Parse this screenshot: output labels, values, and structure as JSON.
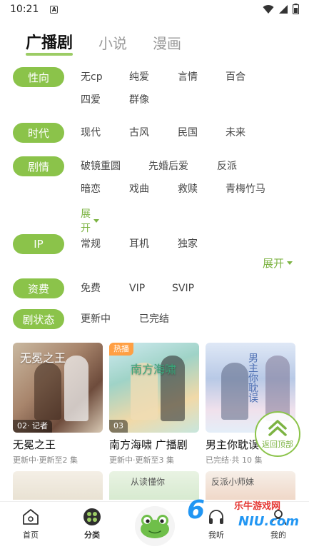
{
  "status_bar": {
    "time": "10:21",
    "notif_icon_letter": "A",
    "icons": [
      "wifi-icon",
      "signal-icon",
      "battery-icon"
    ]
  },
  "tabs": [
    {
      "label": "广播剧",
      "active": true
    },
    {
      "label": "小说",
      "active": false
    },
    {
      "label": "漫画",
      "active": false
    }
  ],
  "filters": {
    "xingxiang": {
      "label": "性向",
      "options": [
        "无cp",
        "纯爱",
        "言情",
        "百合",
        "四爱",
        "群像"
      ]
    },
    "shidai": {
      "label": "时代",
      "options": [
        "现代",
        "古风",
        "民国",
        "未来"
      ]
    },
    "juqing": {
      "label": "剧情",
      "options": [
        "破镜重圆",
        "先婚后爱",
        "反派",
        "暗恋",
        "戏曲",
        "救赎",
        "青梅竹马"
      ],
      "expand": "展开"
    },
    "ip": {
      "label": "IP",
      "options": [
        "常规",
        "耳机",
        "独家"
      ],
      "expand": "展开"
    },
    "zifei": {
      "label": "资费",
      "options": [
        "免费",
        "VIP",
        "SVIP"
      ]
    },
    "juzhuangtai": {
      "label": "剧状态",
      "options": [
        "更新中",
        "已完结"
      ]
    }
  },
  "cards": [
    {
      "title": "无冕之王",
      "status": "更新中·更新至2 集",
      "episode_badge": "02· 记者",
      "cover_text": "无冕之王"
    },
    {
      "title": "南方海啸 广播剧",
      "status": "更新中·更新至3 集",
      "episode_badge": "03",
      "hot_badge": "热播",
      "cover_text": "南方海啸"
    },
    {
      "title": "男主你耽误",
      "status": "已完结·共 10 集",
      "cover_text": "男主你耽误"
    }
  ],
  "cards_row2": [
    {
      "cover_text": ""
    },
    {
      "cover_text": "从读懂你"
    },
    {
      "cover_text": "反派小师妹"
    }
  ],
  "back_to_top": {
    "label": "返回顶部"
  },
  "bottom_nav": [
    {
      "label": "首页",
      "icon": "home-icon"
    },
    {
      "label": "分类",
      "icon": "category-icon"
    },
    {
      "label": "",
      "icon": "frog-icon"
    },
    {
      "label": "我听",
      "icon": "headphones-icon"
    },
    {
      "label": "我的",
      "icon": "profile-icon"
    }
  ],
  "watermark": {
    "brand": "乐牛游戏网",
    "logo_big": "6",
    "logo_small": "NIU.com"
  },
  "colors": {
    "accent": "#8bc34a",
    "accent_text": "#7cb342",
    "hot": "#ff9f43"
  }
}
